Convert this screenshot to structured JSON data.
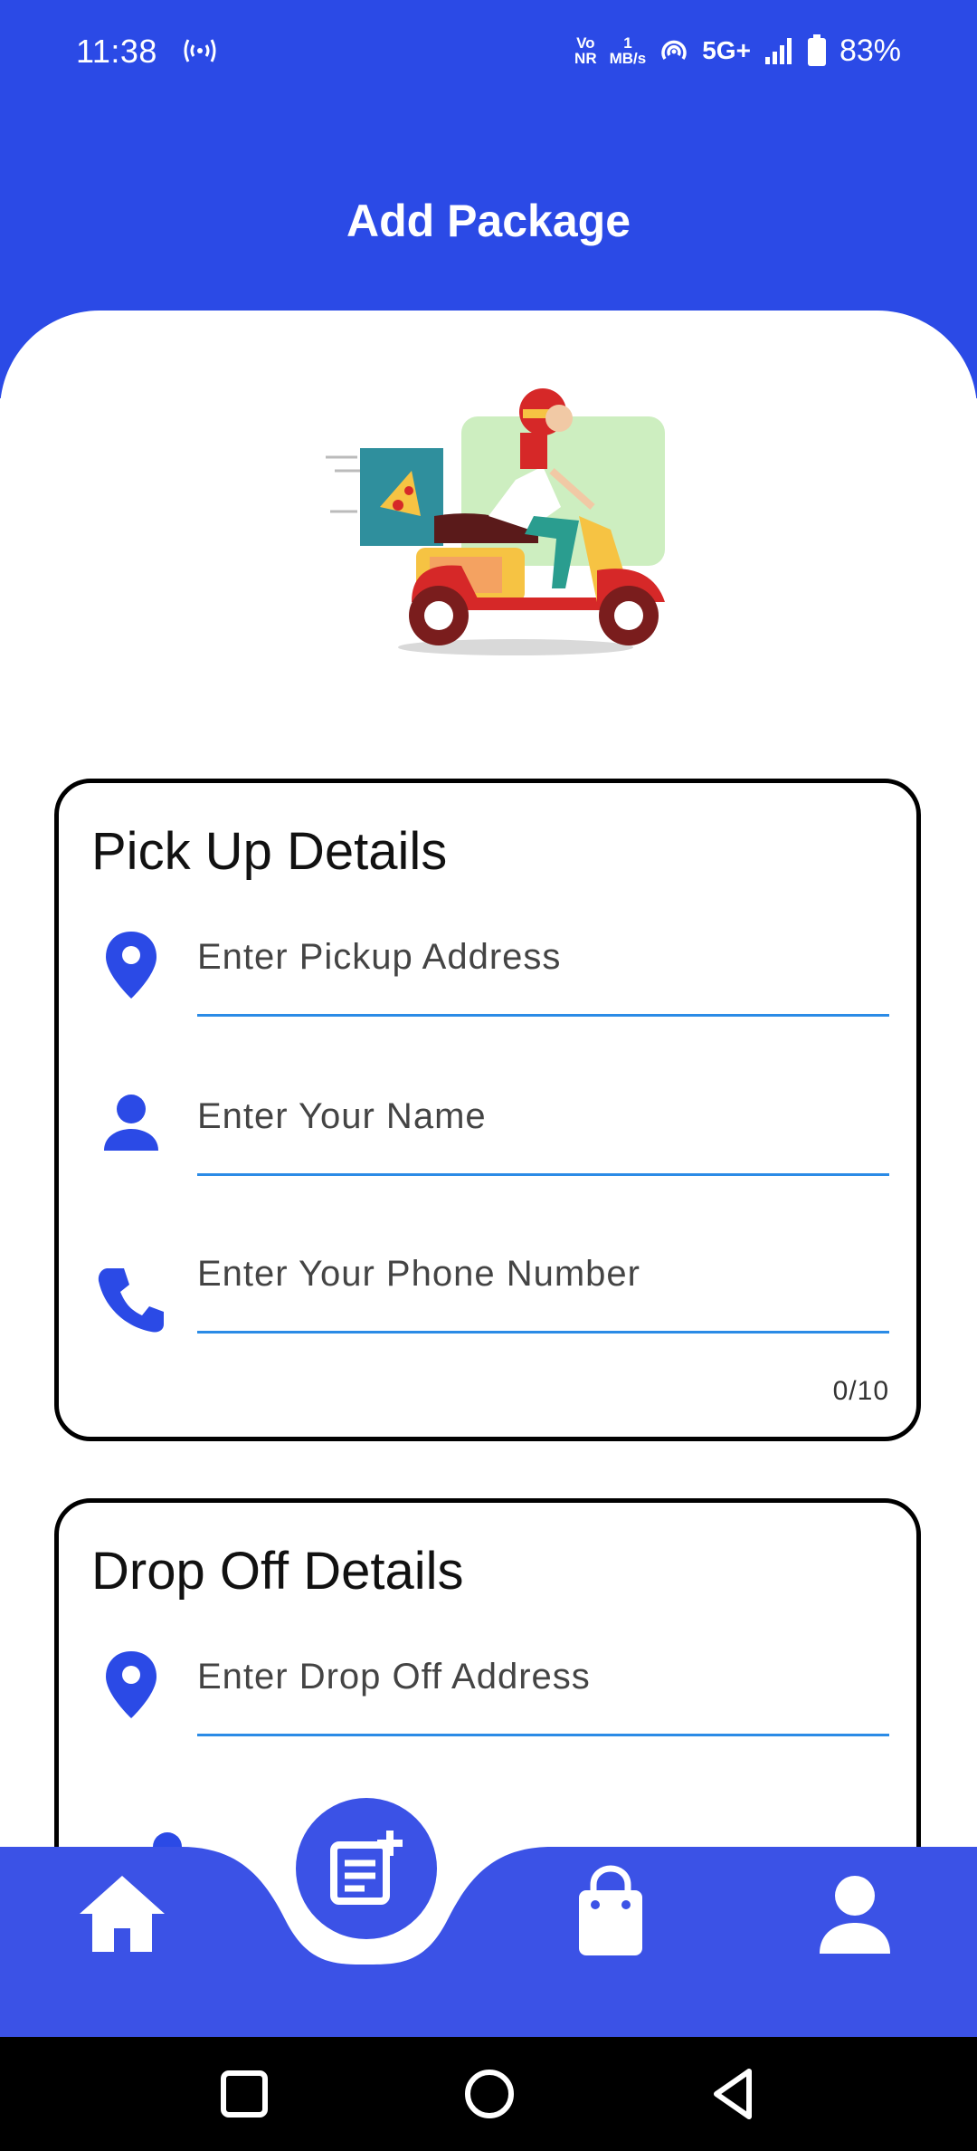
{
  "status_bar": {
    "time": "11:38",
    "volte_top": "Vo",
    "volte_bottom": "NR",
    "speed_value": "1",
    "speed_unit": "MB/s",
    "network": "5G+",
    "battery": "83%"
  },
  "header": {
    "title": "Add Package"
  },
  "pickup": {
    "title": "Pick Up Details",
    "address_placeholder": "Enter Pickup Address",
    "name_placeholder": "Enter Your Name",
    "phone_placeholder": "Enter Your Phone Number",
    "phone_counter": "0/10"
  },
  "dropoff": {
    "title": "Drop Off Details",
    "address_placeholder": "Enter Drop Off Address"
  },
  "bottom_nav": {
    "items": [
      "home-icon",
      "add-package-icon",
      "shopping-bag-icon",
      "person-icon"
    ]
  },
  "system_nav": {
    "buttons": [
      "recents",
      "home",
      "back"
    ]
  },
  "colors": {
    "primary": "#2B4AE6",
    "nav_bg": "#3B52E6",
    "field_underline": "#2B8BE6",
    "card_border": "#000000"
  }
}
